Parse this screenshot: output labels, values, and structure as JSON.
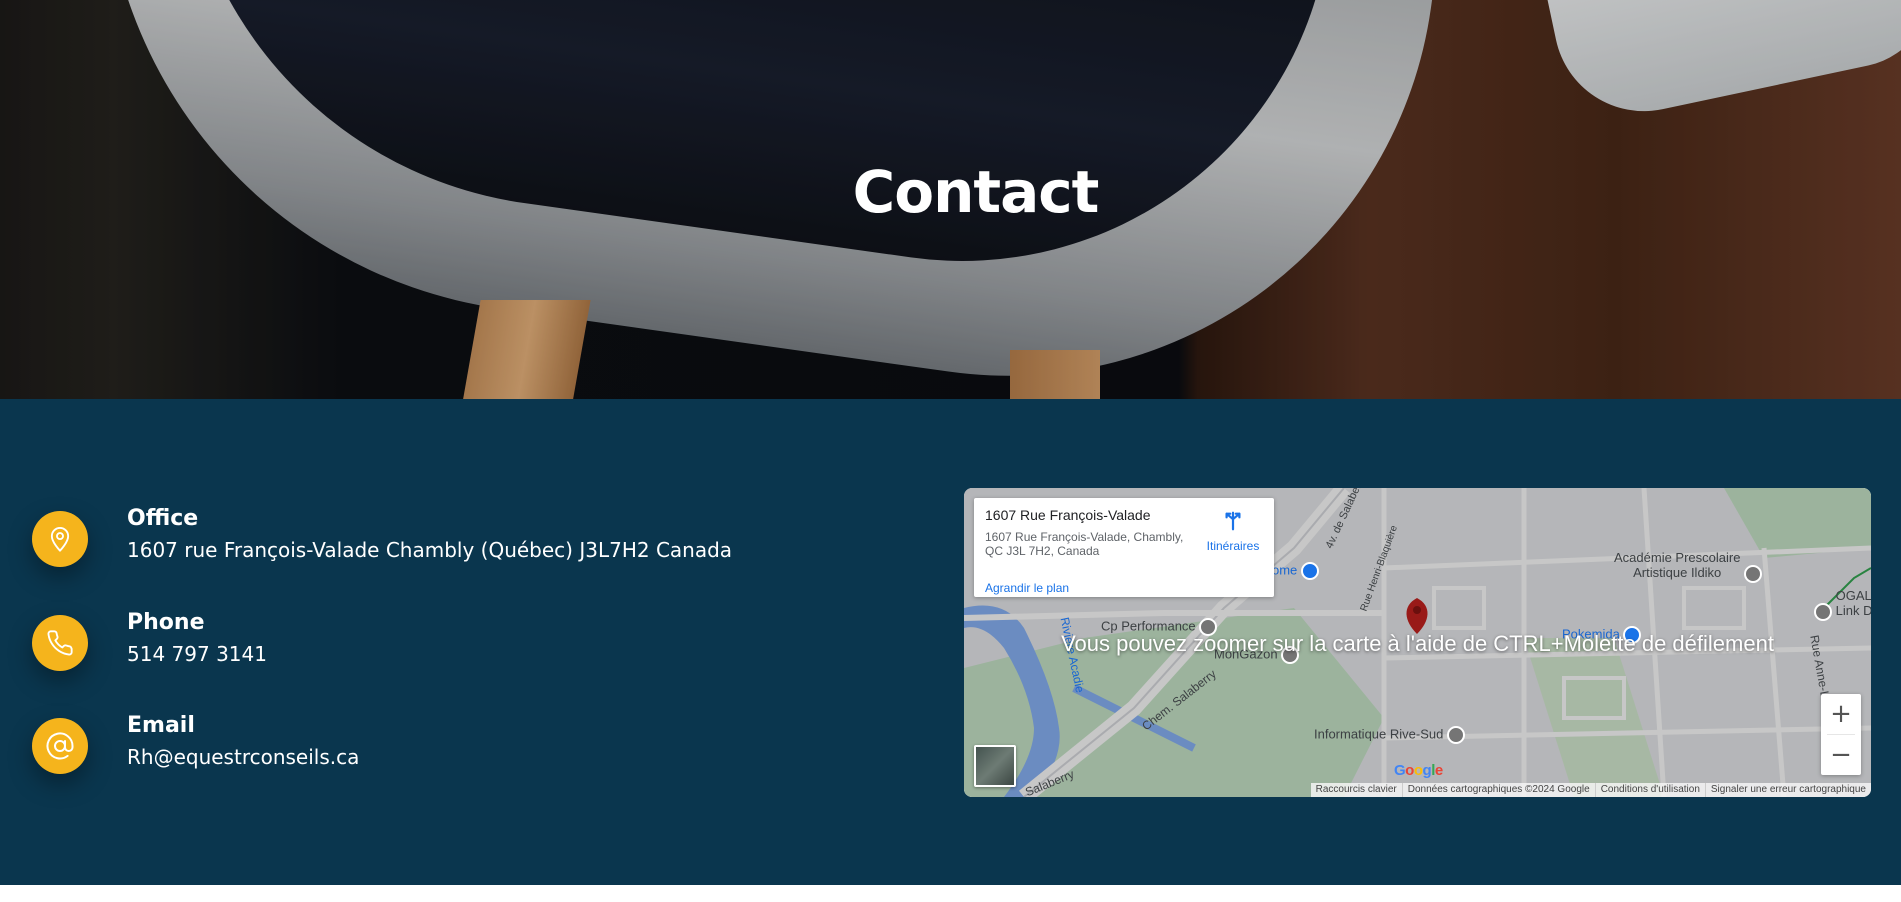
{
  "hero": {
    "title": "Contact"
  },
  "contact_items": [
    {
      "icon": "map-pin-icon",
      "title": "Office",
      "value": "1607 rue François-Valade Chambly (Québec) J3L7H2 Canada"
    },
    {
      "icon": "phone-icon",
      "title": "Phone",
      "value": "514 797 3141"
    },
    {
      "icon": "at-sign-icon",
      "title": "Email",
      "value": "Rh@equestrconseils.ca"
    }
  ],
  "map": {
    "place_name": "1607 Rue François-Valade",
    "place_address": "1607 Rue François-Valade, Chambly, QC J3L 7H2, Canada",
    "directions_label": "Itinéraires",
    "enlarge_label": "Agrandir le plan",
    "zoom_hint": "Vous pouvez zoomer sur la carte à l'aide de CTRL+Molette de défilement",
    "zoom_in": "+",
    "zoom_out": "−",
    "google_logo": "Google",
    "footer": {
      "shortcuts": "Raccourcis clavier",
      "map_data": "Données cartographiques ©2024 Google",
      "terms": "Conditions d'utilisation",
      "report": "Signaler une erreur cartographique"
    },
    "labels": {
      "academy": "Académie Prescolaire\nArtistique Ildiko",
      "ogalo": "OGALO\nLink D",
      "pokemida": "Pokemida",
      "cp_performance": "Cp Performance",
      "mongazon": "MonGazon",
      "informatique": "Informatique Rive-Sud",
      "salaberry_chem": "Chem. Salaberry",
      "salaberry": "Salaberry",
      "riviere_acadie": "Rivière Acadie",
      "henri_blaquiere": "Rue Henri-Blaquière",
      "anne_le_seigneur": "Rue Anne-Le Seigneur",
      "ave_salaberry": "4v. de Salaberry",
      "home": "ome"
    },
    "colors": {
      "pin": "#c5221f",
      "link": "#1a73e8"
    }
  },
  "colors": {
    "section_bg": "#0a364e",
    "icon_circle": "#f5b41c"
  }
}
